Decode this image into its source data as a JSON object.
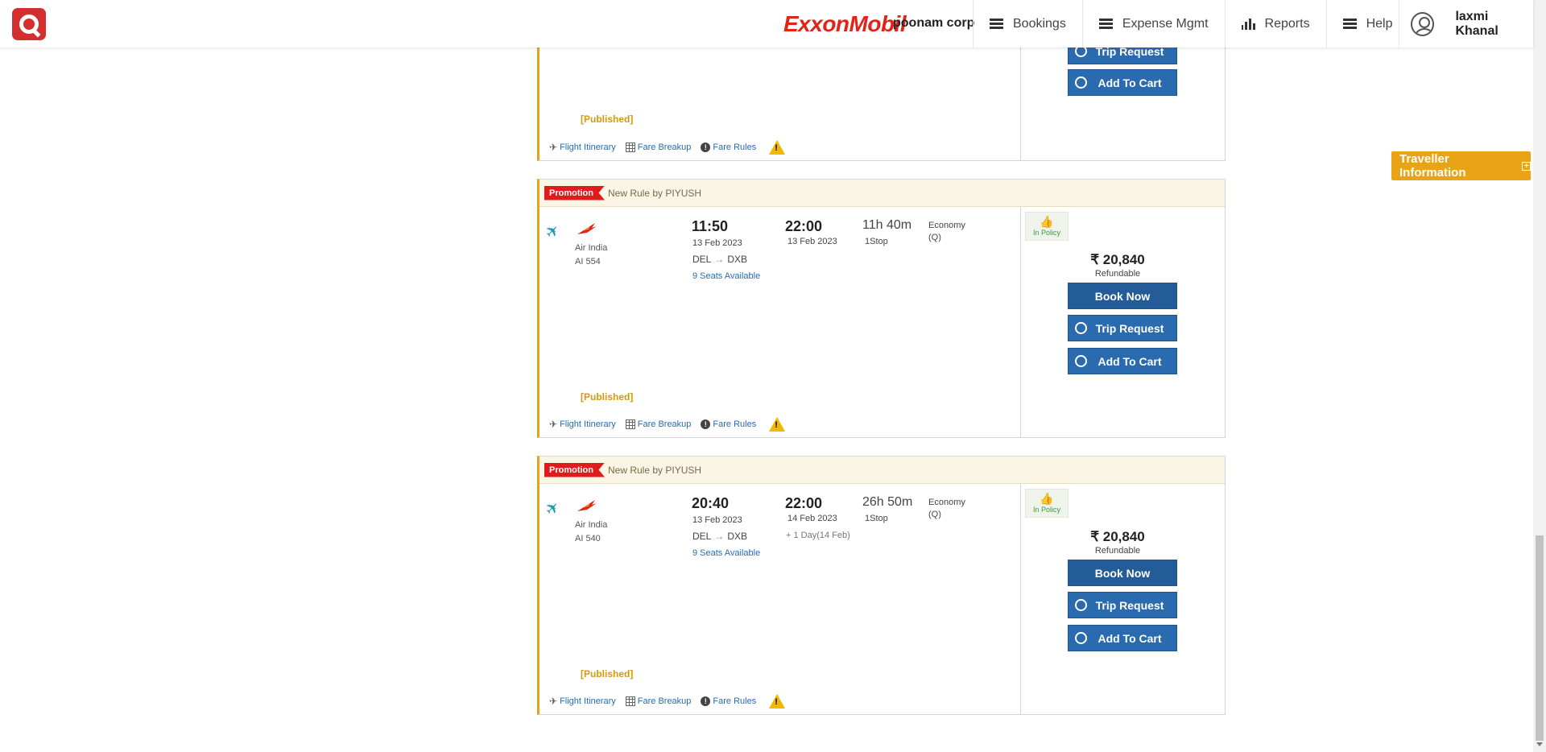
{
  "header": {
    "brand": "ExxonMobil",
    "company": "poonam corp",
    "nav": [
      "Bookings",
      "Expense Mgmt",
      "Reports",
      "Help"
    ],
    "user": "laxmi Khanal"
  },
  "traveller_tab": {
    "label": "Traveller Information",
    "icon": "plus-box-icon"
  },
  "top_card": {
    "published": "[Published]",
    "trip_request": "Trip Request",
    "add_to_cart": "Add To Cart",
    "links": {
      "itinerary": "Flight Itinerary",
      "breakup": "Fare Breakup",
      "rules": "Fare Rules"
    }
  },
  "flights": [
    {
      "promo_tag": "Promotion",
      "promo_text": "New Rule by PIYUSH",
      "airline": "Air India",
      "flight_no": "AI  554",
      "dep_time": "11:50",
      "dep_date": "13 Feb 2023",
      "from": "DEL",
      "to": "DXB",
      "seats": "9 Seats Available",
      "arr_time": "22:00",
      "arr_date": "13 Feb 2023",
      "plus_day": "",
      "duration": "11h 40m",
      "stops": "1Stop",
      "cabin": "Economy",
      "cabin_class": "(Q)",
      "policy": "In Policy",
      "price": "₹ 20,840",
      "refund": "Refundable",
      "book_now": "Book Now",
      "trip_request": "Trip Request",
      "add_to_cart": "Add To Cart",
      "published": "[Published]",
      "links": {
        "itinerary": "Flight Itinerary",
        "breakup": "Fare Breakup",
        "rules": "Fare Rules"
      }
    },
    {
      "promo_tag": "Promotion",
      "promo_text": "New Rule by PIYUSH",
      "airline": "Air India",
      "flight_no": "AI  540",
      "dep_time": "20:40",
      "dep_date": "13 Feb 2023",
      "from": "DEL",
      "to": "DXB",
      "seats": "9 Seats Available",
      "arr_time": "22:00",
      "arr_date": "14 Feb 2023",
      "plus_day": "+ 1 Day(14 Feb)",
      "duration": "26h 50m",
      "stops": "1Stop",
      "cabin": "Economy",
      "cabin_class": "(Q)",
      "policy": "In Policy",
      "price": "₹ 20,840",
      "refund": "Refundable",
      "book_now": "Book Now",
      "trip_request": "Trip Request",
      "add_to_cart": "Add To Cart",
      "published": "[Published]",
      "links": {
        "itinerary": "Flight Itinerary",
        "breakup": "Fare Breakup",
        "rules": "Fare Rules"
      }
    }
  ],
  "colors": {
    "brand_red": "#e2231a",
    "accent_orange": "#e8a317",
    "button_blue": "#2a6bb0",
    "link_blue": "#2a6bb0",
    "policy_green": "#3a9a3a"
  }
}
